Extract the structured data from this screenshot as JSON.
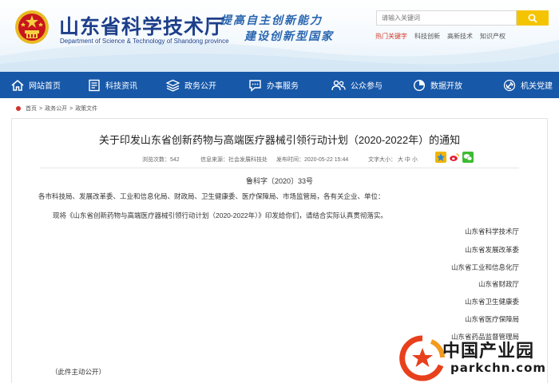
{
  "header": {
    "site_title": "山东省科学技术厅",
    "site_subtitle": "Department of Science & Technology of Shandong province",
    "slogan_line1": "提高自主创新能力",
    "slogan_line2": "建设创新型国家",
    "search": {
      "placeholder": "请输入关键词"
    },
    "hot_links": {
      "label": "热门关键字",
      "items": [
        "科技创新",
        "高新技术",
        "知识产权"
      ]
    }
  },
  "nav": {
    "items": [
      {
        "label": "网站首页",
        "icon": "home-icon"
      },
      {
        "label": "科技资讯",
        "icon": "news-icon"
      },
      {
        "label": "政务公开",
        "icon": "layers-icon"
      },
      {
        "label": "办事服务",
        "icon": "chat-icon"
      },
      {
        "label": "公众参与",
        "icon": "people-icon"
      },
      {
        "label": "数据开放",
        "icon": "data-icon"
      },
      {
        "label": "机关党建",
        "icon": "party-icon"
      }
    ]
  },
  "breadcrumb": [
    "首页",
    "政务公开",
    "政策文件"
  ],
  "article": {
    "title": "关于印发山东省创新药物与高端医疗器械引领行动计划（2020-2022年）的通知",
    "meta": {
      "views": "浏览次数：542",
      "source": "信息来源：社会发展科技处",
      "date": "发布时间：2020-05-22 15:44",
      "font_size_label": "文字大小：",
      "font_large": "大",
      "font_medium": "中",
      "font_small": "小"
    },
    "doc_number": "鲁科字〔2020〕33号",
    "recipients": "各市科技局、发展改革委、工业和信息化局、财政局、卫生健康委、医疗保障局、市场监管局，各有关企业、单位：",
    "paragraph": "现将《山东省创新药物与高端医疗器械引领行动计划（2020-2022年）》印发给你们，请结合实际认真贯彻落实。",
    "signatories": [
      "山东省科学技术厅",
      "山东省发展改革委",
      "山东省工业和信息化厅",
      "山东省财政厅",
      "山东省卫生健康委",
      "山东省医疗保障局",
      "山东省药品监督管理局"
    ],
    "footer_note": "（此件主动公开）"
  },
  "watermark": {
    "text": "中国产业园",
    "url": "parkchn.com"
  },
  "colors": {
    "nav_bg": "#1758a8",
    "title_blue": "#1d3f8a",
    "search_btn": "#f5c400",
    "hot_red": "#d23a2a"
  }
}
